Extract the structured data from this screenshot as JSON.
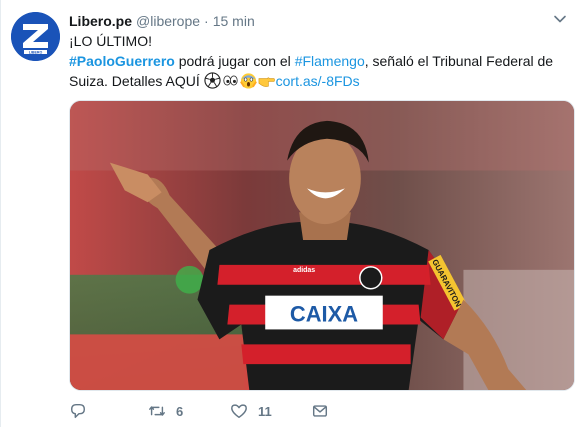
{
  "tweet": {
    "display_name": "Libero.pe",
    "handle": "@liberope",
    "separator": "·",
    "time": "15 min",
    "avatar_logo_text": "LIBERO",
    "line1": "¡LO ÚLTIMO!",
    "hashtag_player": "#PaoloGuerrero",
    "text_middle": " podrá jugar con el ",
    "hashtag_team": "#Flamengo",
    "text_after_team": ", señaló el Tribunal Federal de",
    "text_line3": "Suiza. Detalles AQUÍ ",
    "link": "cort.as/-8FDs",
    "emojis": [
      "soccer-ball-emoji",
      "eyes-emoji",
      "screaming-face-emoji",
      "pointing-right-emoji"
    ],
    "image": {
      "jersey_sponsor": "CAIXA",
      "sleeve_sponsor": "GUARAVITON",
      "sleeve_brand": "adidas",
      "colors": {
        "jersey_red": "#d4202b",
        "jersey_black": "#1b1b1b",
        "background": "#8b4a4a"
      }
    }
  },
  "actions": {
    "reply_count": "",
    "retweet_count": "6",
    "like_count": "11"
  },
  "colors": {
    "link": "#1b95e0",
    "secondary": "#657786",
    "text": "#14171a",
    "avatar_bg": "#1a53b8"
  }
}
